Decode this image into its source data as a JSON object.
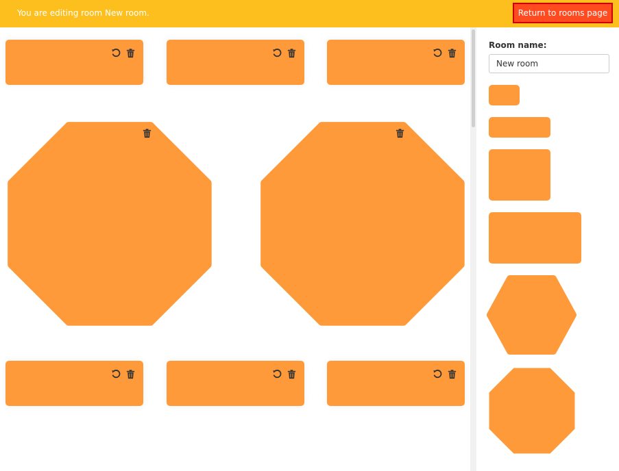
{
  "header": {
    "message": "You are editing room New room.",
    "return_button": "Return to rooms page"
  },
  "sidebar": {
    "room_name_label": "Room name:",
    "room_name_value": "New room"
  },
  "colors": {
    "topbar": "#fcbf1e",
    "table_fill": "#ff9a3a",
    "return_button": "#ff4b1f"
  },
  "icons": {
    "rotate": "rotate-icon",
    "delete": "trash-icon"
  }
}
